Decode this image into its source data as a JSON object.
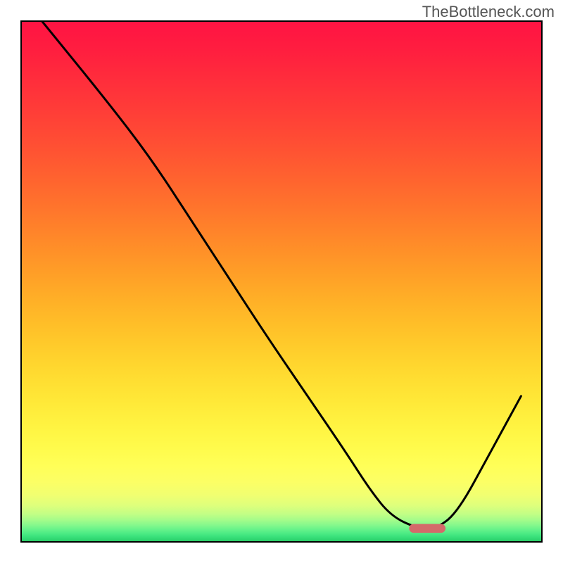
{
  "watermark": "TheBottleneck.com",
  "chart_data": {
    "type": "line",
    "title": "",
    "xlabel": "",
    "ylabel": "",
    "xlim": [
      0,
      100
    ],
    "ylim": [
      0,
      100
    ],
    "grid": false,
    "legend": false,
    "background_gradient": {
      "stops": [
        {
          "offset": 0.0,
          "color": "#ff1343"
        },
        {
          "offset": 0.06,
          "color": "#ff1f3f"
        },
        {
          "offset": 0.12,
          "color": "#ff2f3b"
        },
        {
          "offset": 0.18,
          "color": "#ff3f37"
        },
        {
          "offset": 0.24,
          "color": "#ff5033"
        },
        {
          "offset": 0.3,
          "color": "#ff622f"
        },
        {
          "offset": 0.36,
          "color": "#ff752c"
        },
        {
          "offset": 0.42,
          "color": "#ff8929"
        },
        {
          "offset": 0.48,
          "color": "#ff9d27"
        },
        {
          "offset": 0.54,
          "color": "#ffb127"
        },
        {
          "offset": 0.6,
          "color": "#ffc429"
        },
        {
          "offset": 0.66,
          "color": "#ffd62e"
        },
        {
          "offset": 0.72,
          "color": "#ffe636"
        },
        {
          "offset": 0.78,
          "color": "#fff442"
        },
        {
          "offset": 0.82,
          "color": "#fffb4c"
        },
        {
          "offset": 0.855,
          "color": "#ffff58"
        },
        {
          "offset": 0.885,
          "color": "#fcff65"
        },
        {
          "offset": 0.91,
          "color": "#f1ff71"
        },
        {
          "offset": 0.93,
          "color": "#deff7c"
        },
        {
          "offset": 0.946,
          "color": "#c3fe85"
        },
        {
          "offset": 0.958,
          "color": "#a4fc8a"
        },
        {
          "offset": 0.968,
          "color": "#84f88c"
        },
        {
          "offset": 0.976,
          "color": "#67f38a"
        },
        {
          "offset": 0.983,
          "color": "#4fec85"
        },
        {
          "offset": 0.989,
          "color": "#3de37d"
        },
        {
          "offset": 0.994,
          "color": "#31d973"
        },
        {
          "offset": 0.998,
          "color": "#2bce68"
        },
        {
          "offset": 1.0,
          "color": "#29c860"
        }
      ]
    },
    "series": [
      {
        "name": "bottleneck-curve",
        "color": "#000000",
        "x": [
          4,
          17,
          25,
          32.5,
          40,
          47.5,
          55,
          62.5,
          67,
          71,
          76,
          80,
          84,
          90,
          96
        ],
        "y": [
          100,
          84,
          73.5,
          62,
          50.5,
          39,
          28,
          17,
          10,
          5,
          2.6,
          2.6,
          6,
          17,
          28
        ]
      }
    ],
    "markers": [
      {
        "name": "optimal-range-marker",
        "type": "pill",
        "x_center": 78,
        "y_center": 2.6,
        "width": 7,
        "height": 1.7,
        "color": "#d46a6a"
      }
    ],
    "axis_frame": {
      "color": "#000000",
      "width": 2
    }
  }
}
